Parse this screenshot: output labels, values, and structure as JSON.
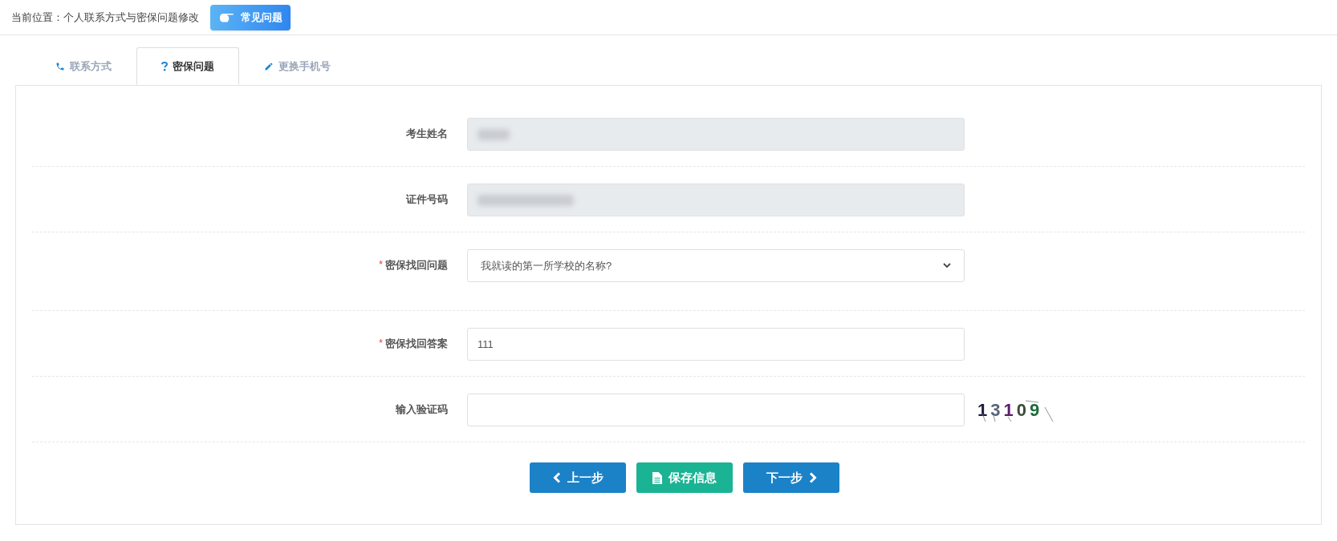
{
  "breadcrumb": {
    "label": "当前位置：个人联系方式与密保问题修改",
    "faq_button": "常见问题"
  },
  "tabs": [
    {
      "label": "联系方式",
      "selected": false
    },
    {
      "label": "密保问题",
      "selected": true
    },
    {
      "label": "更换手机号",
      "selected": false
    }
  ],
  "form": {
    "rows": [
      {
        "kind": "readonly",
        "label": "考生姓名"
      },
      {
        "kind": "readonly",
        "label": "证件号码"
      },
      {
        "kind": "select",
        "label": "密保找回问题",
        "required_mark": "*",
        "value": "我就读的第一所学校的名称?"
      },
      {
        "kind": "input",
        "label": "密保找回答案",
        "required_mark": "*",
        "value": "111"
      },
      {
        "kind": "captcha",
        "label": "输入验证码",
        "captcha": [
          {
            "char": "1",
            "color": "#1b1b3c"
          },
          {
            "char": "3",
            "color": "#5a6478"
          },
          {
            "char": "1",
            "color": "#5b1f6b"
          },
          {
            "char": "0",
            "color": "#3c4a3a"
          },
          {
            "char": "9",
            "color": "#1d6b3a"
          }
        ]
      }
    ]
  },
  "buttons": [
    {
      "kind": "prev",
      "label": "上一步"
    },
    {
      "kind": "save",
      "label": "保存信息"
    },
    {
      "kind": "next",
      "label": "下一步"
    }
  ]
}
